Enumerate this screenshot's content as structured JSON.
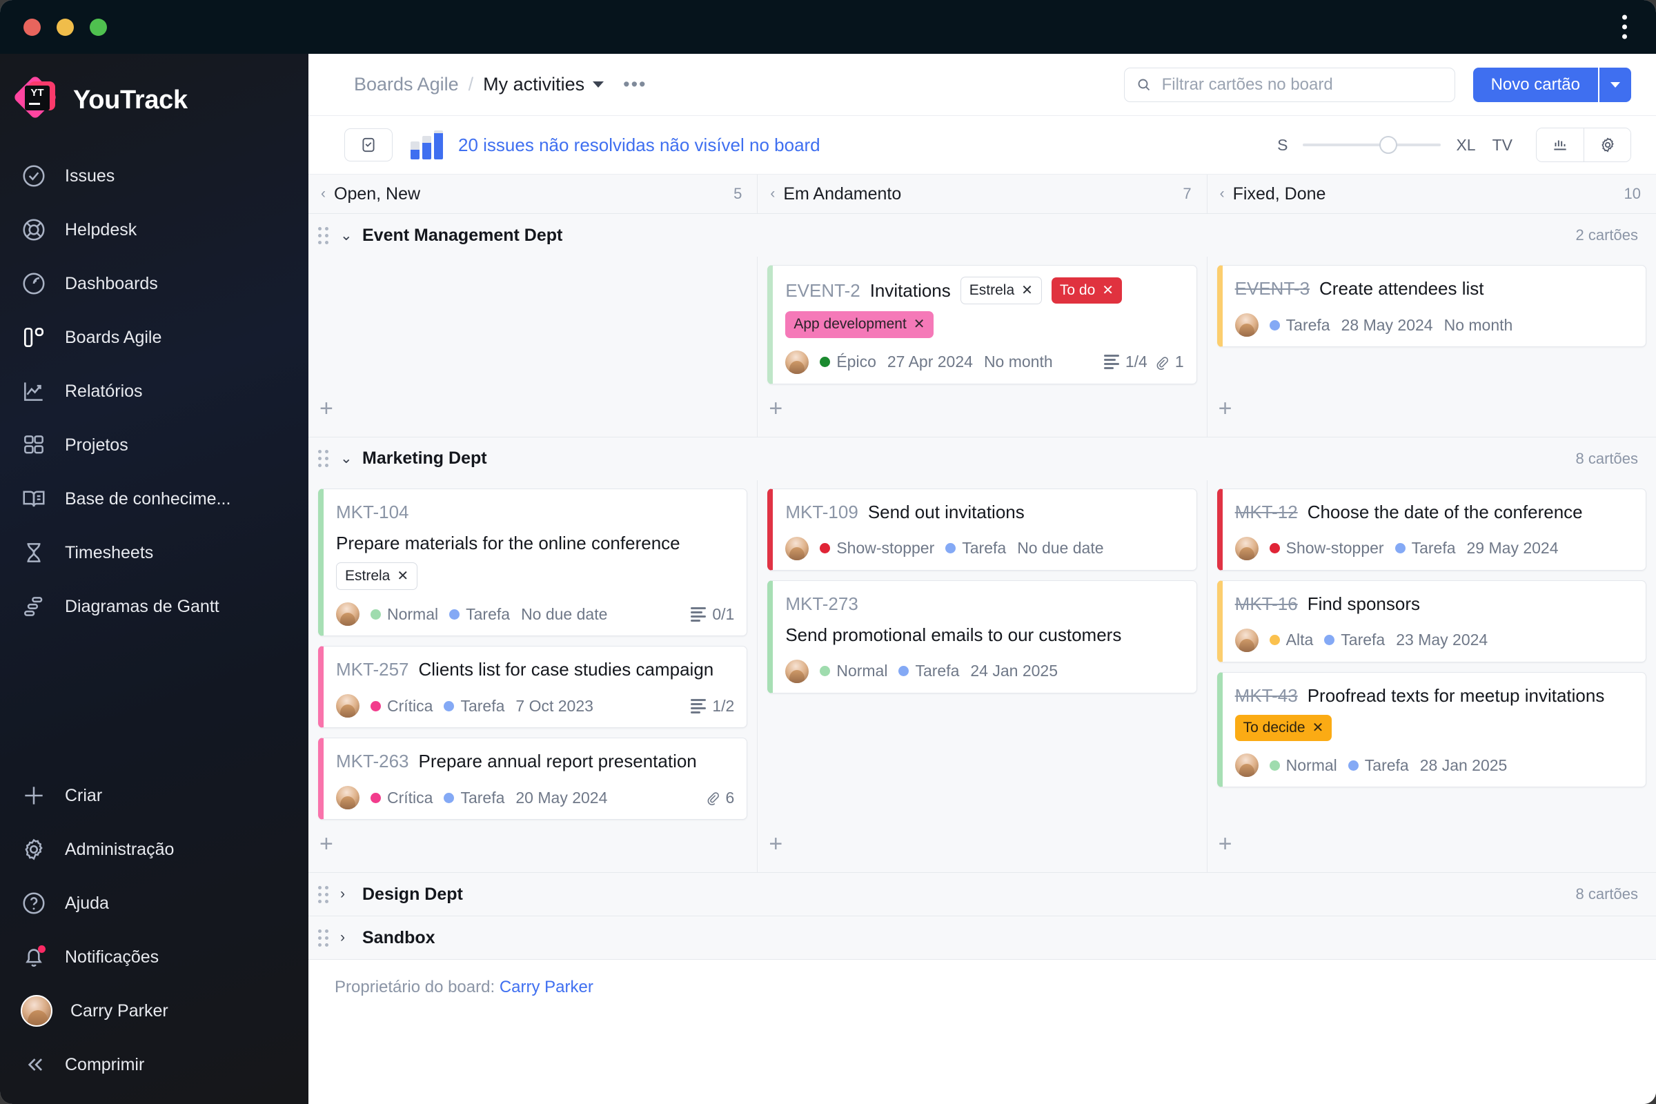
{
  "window": {
    "traffic_lights": [
      "close",
      "minimize",
      "maximize"
    ],
    "menu_icon": "kebab-menu-icon"
  },
  "sidebar": {
    "brand": "YouTrack",
    "logo_text": "YT",
    "items": [
      {
        "label": "Issues",
        "icon": "check-circle-icon"
      },
      {
        "label": "Helpdesk",
        "icon": "lifebuoy-icon"
      },
      {
        "label": "Dashboards",
        "icon": "radar-icon"
      },
      {
        "label": "Boards Agile",
        "icon": "board-columns-icon",
        "active": true
      },
      {
        "label": "Relatórios",
        "icon": "chart-line-icon"
      },
      {
        "label": "Projetos",
        "icon": "grid-squares-icon"
      },
      {
        "label": "Base de conhecime...",
        "icon": "open-book-icon"
      },
      {
        "label": "Timesheets",
        "icon": "hourglass-icon"
      },
      {
        "label": "Diagramas de Gantt",
        "icon": "gantt-icon"
      }
    ],
    "bottom_items": [
      {
        "label": "Criar",
        "icon": "plus-icon"
      },
      {
        "label": "Administração",
        "icon": "gear-icon"
      },
      {
        "label": "Ajuda",
        "icon": "question-circle-icon"
      },
      {
        "label": "Notificações",
        "icon": "bell-icon",
        "badge": true
      }
    ],
    "user": {
      "label": "Carry Parker",
      "icon": "avatar"
    },
    "collapse": {
      "label": "Comprimir",
      "icon": "chevron-double-left-icon"
    }
  },
  "topbar": {
    "breadcrumb_root": "Boards Agile",
    "breadcrumb_sep": "/",
    "breadcrumb_current": "My activities",
    "more_dots": "•••",
    "search_placeholder": "Filtrar cartões no board",
    "search_value": "",
    "new_card_label": "Novo cartão"
  },
  "toolbar": {
    "inbox_icon": "card-tray-icon",
    "chart_icon": "bar-chart-icon",
    "issues_link": "20 issues não resolvidas não visível no board",
    "size_min": "S",
    "size_max": "XL",
    "tv_label": "TV",
    "slider_position_pct": 62,
    "chart_view_icon": "chart-bars-icon",
    "settings_icon": "gear-icon"
  },
  "columns": [
    {
      "title": "Open, New",
      "count": "5"
    },
    {
      "title": "Em Andamento",
      "count": "7"
    },
    {
      "title": "Fixed, Done",
      "count": "10"
    }
  ],
  "swimlanes": [
    {
      "title": "Event Management Dept",
      "count": "2 cartões",
      "expanded": true,
      "cells": [
        {
          "cards": []
        },
        {
          "cards": [
            {
              "id": "EVENT-2",
              "resolved": false,
              "summary": "Invitations",
              "accent": "#bfe6c8",
              "tags": [
                {
                  "label": "Estrela",
                  "style": "outline"
                },
                {
                  "label": "To do",
                  "style": "red"
                },
                {
                  "label": "App development",
                  "style": "pink"
                }
              ],
              "meta": {
                "date": "27 Apr 2024",
                "month": "No month",
                "priority": "Épico",
                "priority_color": "#1b8a2f",
                "type": "",
                "type_color": "",
                "checklist": "1/4",
                "attachments": "1"
              }
            }
          ]
        },
        {
          "cards": [
            {
              "id": "EVENT-3",
              "resolved": true,
              "summary": "Create attendees list",
              "accent": "#fcce6e",
              "tags": [],
              "meta": {
                "date": "28 May 2024",
                "month": "No month",
                "priority": "",
                "priority_color": "",
                "type": "Tarefa",
                "type_color": "#84a9f5",
                "checklist": "",
                "attachments": ""
              }
            }
          ]
        }
      ]
    },
    {
      "title": "Marketing Dept",
      "count": "8 cartões",
      "expanded": true,
      "cells": [
        {
          "cards": [
            {
              "id": "MKT-104",
              "resolved": false,
              "summary": "Prepare materials for the online conference",
              "accent": "#a7dfb4",
              "tags": [
                {
                  "label": "Estrela",
                  "style": "outline"
                }
              ],
              "meta": {
                "date": "No due date",
                "month": "",
                "priority": "Normal",
                "priority_color": "#9fdcae",
                "type": "Tarefa",
                "type_color": "#84a9f5",
                "checklist": "0/1",
                "attachments": ""
              }
            },
            {
              "id": "MKT-257",
              "resolved": false,
              "summary": "Clients list for case studies campaign",
              "accent": "#f973ab",
              "tags": [],
              "meta": {
                "date": "7 Oct 2023",
                "month": "",
                "priority": "Crítica",
                "priority_color": "#f23c8c",
                "type": "Tarefa",
                "type_color": "#84a9f5",
                "checklist": "1/2",
                "attachments": ""
              }
            },
            {
              "id": "MKT-263",
              "resolved": false,
              "summary": "Prepare annual report presentation",
              "accent": "#f973ab",
              "tags": [],
              "meta": {
                "date": "20 May 2024",
                "month": "",
                "priority": "Crítica",
                "priority_color": "#f23c8c",
                "type": "Tarefa",
                "type_color": "#84a9f5",
                "checklist": "",
                "attachments": "6"
              }
            }
          ]
        },
        {
          "cards": [
            {
              "id": "MKT-109",
              "resolved": false,
              "summary": "Send out invitations",
              "accent": "#e03344",
              "tags": [],
              "meta": {
                "date": "No due date",
                "month": "",
                "priority": "Show-stopper",
                "priority_color": "#e02436",
                "type": "Tarefa",
                "type_color": "#84a9f5",
                "checklist": "",
                "attachments": ""
              }
            },
            {
              "id": "MKT-273",
              "resolved": false,
              "summary": "Send promotional emails to our customers",
              "accent": "#a7dfb4",
              "tags": [],
              "meta": {
                "date": "24 Jan 2025",
                "month": "",
                "priority": "Normal",
                "priority_color": "#9fdcae",
                "type": "Tarefa",
                "type_color": "#84a9f5",
                "checklist": "",
                "attachments": ""
              }
            }
          ]
        },
        {
          "cards": [
            {
              "id": "MKT-12",
              "resolved": true,
              "summary": "Choose the date of the conference",
              "accent": "#e03344",
              "tags": [],
              "meta": {
                "date": "29 May 2024",
                "month": "",
                "priority": "Show-stopper",
                "priority_color": "#e02436",
                "type": "Tarefa",
                "type_color": "#84a9f5",
                "checklist": "",
                "attachments": ""
              }
            },
            {
              "id": "MKT-16",
              "resolved": true,
              "summary": "Find sponsors",
              "accent": "#fcce6e",
              "tags": [],
              "meta": {
                "date": "23 May 2024",
                "month": "",
                "priority": "Alta",
                "priority_color": "#fbc14e",
                "type": "Tarefa",
                "type_color": "#84a9f5",
                "checklist": "",
                "attachments": ""
              }
            },
            {
              "id": "MKT-43",
              "resolved": true,
              "summary": "Proofread texts for meetup invitations",
              "accent": "#a7dfb4",
              "tags": [
                {
                  "label": "To decide",
                  "style": "orange"
                }
              ],
              "meta": {
                "date": "28 Jan 2025",
                "month": "",
                "priority": "Normal",
                "priority_color": "#9fdcae",
                "type": "Tarefa",
                "type_color": "#84a9f5",
                "checklist": "",
                "attachments": ""
              }
            }
          ]
        }
      ]
    },
    {
      "title": "Design Dept",
      "count": "8 cartões",
      "expanded": false,
      "cells": []
    },
    {
      "title": "Sandbox",
      "count": "",
      "expanded": false,
      "cells": []
    }
  ],
  "footer": {
    "label": "Proprietário do board:",
    "owner": "Carry Parker"
  }
}
